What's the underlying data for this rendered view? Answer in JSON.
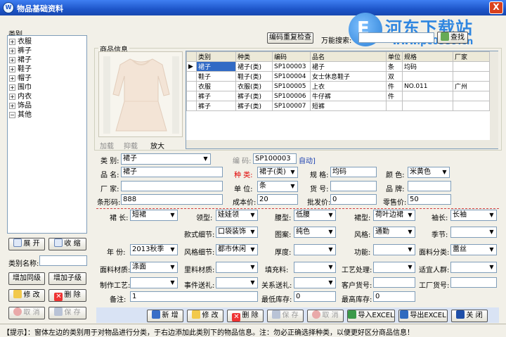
{
  "window": {
    "title": "物品基础资料",
    "icon_label": "W",
    "close_label": "X"
  },
  "watermark": {
    "logo_char": "E",
    "text": "河东下载站",
    "url": "www.pc0359.cn"
  },
  "sidebar": {
    "title": "类别",
    "tree": [
      {
        "sign": "+",
        "label": "衣服"
      },
      {
        "sign": "+",
        "label": "裤子"
      },
      {
        "sign": "+",
        "label": "裙子"
      },
      {
        "sign": "+",
        "label": "鞋子"
      },
      {
        "sign": "+",
        "label": "帽子"
      },
      {
        "sign": "+",
        "label": "围巾"
      },
      {
        "sign": "+",
        "label": "内衣"
      },
      {
        "sign": "+",
        "label": "饰品"
      },
      {
        "sign": "−",
        "label": "其他"
      }
    ],
    "expand_label": "展 开",
    "collapse_label": "收 缩",
    "category_name_label": "类别名称:",
    "category_name_value": "",
    "add_same_level": "增加同级",
    "add_child_level": "增加子级",
    "modify": "修 改",
    "delete": "删 除",
    "cancel": "取 消",
    "save": "保 存"
  },
  "search": {
    "dup_check_label": "编码重复检查",
    "prefix_label": "万能搜索:",
    "query": "",
    "search_label": "查找"
  },
  "goods_info": {
    "section_title": "商品信息",
    "photo_buttons": [
      "加载",
      "抑载",
      "放大"
    ],
    "grid": {
      "columns": [
        "类别",
        "种类",
        "编码",
        "品名",
        "单位",
        "规格",
        "厂家"
      ],
      "rows": [
        {
          "cells": [
            "裙子",
            "裙子(类)",
            "SP100003",
            "裙子",
            "条",
            "均码",
            ""
          ],
          "selected": true
        },
        {
          "cells": [
            "鞋子",
            "鞋子(类)",
            "SP100004",
            "女士休息鞋子",
            "双",
            "",
            ""
          ],
          "selected": false
        },
        {
          "cells": [
            "衣服",
            "衣服(类)",
            "SP100005",
            "上衣",
            "件",
            "NO.011",
            "广州"
          ],
          "selected": false
        },
        {
          "cells": [
            "裤子",
            "裤子(类)",
            "SP100006",
            "牛仔裤",
            "件",
            "",
            ""
          ],
          "selected": false
        },
        {
          "cells": [
            "裤子",
            "裤子(类)",
            "SP100007",
            "短裤",
            "",
            "",
            ""
          ],
          "selected": false
        }
      ]
    }
  },
  "form": {
    "category_label": "类 别:",
    "category_value": "裙子",
    "code_label": "编 码:",
    "code_value": "SP100003",
    "auto_label": "自动]",
    "name_label": "品 名:",
    "name_value": "裙子",
    "kind_label": "种 类:",
    "kind_value": "裙子(类)",
    "spec_label": "规 格:",
    "spec_value": "均码",
    "color_label": "颜 色:",
    "color_value": "米黄色",
    "maker_label": "厂 家:",
    "maker_value": "",
    "unit_label": "单 位:",
    "unit_value": "条",
    "item_no_label": "货 号:",
    "item_no_value": "",
    "brand_label": "品 牌:",
    "brand_value": "",
    "barcode_label": "条形码:",
    "barcode_value": "888",
    "cost_label": "成本价:",
    "cost_value": "20",
    "wholesale_label": "批发价:",
    "wholesale_value": "0",
    "retail_label": "零售价:",
    "retail_value": "50"
  },
  "attributes": {
    "skirt_length_label": "裙 长:",
    "skirt_length_value": "短裙",
    "collar_label": "领型:",
    "collar_value": "娃娃领",
    "waist_label": "腰型:",
    "waist_value": "低腰",
    "skirt_type_label": "裙型:",
    "skirt_type_value": "荷叶边裙",
    "sleeve_label": "袖长:",
    "sleeve_value": "长袖",
    "style_detail_label": "款式细节:",
    "style_detail_value": "口袋装饰",
    "pattern_label": "图案:",
    "pattern_value": "纯色",
    "style_label": "风格:",
    "style_value": "通勤",
    "season_label": "季节:",
    "season_value": "",
    "year_label": "年 份:",
    "year_value": "2013秋季",
    "style_detail2_label": "风格细节:",
    "style_detail2_value": "都市休闲",
    "thickness_label": "厚度:",
    "thickness_value": "",
    "function_label": "功能:",
    "function_value": "",
    "fabric_class_label": "面料分类:",
    "fabric_class_value": "蕾丝",
    "fabric_label": "面料材质:",
    "fabric_value": "涤面",
    "lining_label": "里料材质:",
    "lining_value": "",
    "filling_label": "填充料:",
    "filling_value": "",
    "process_label": "工艺处理:",
    "process_value": "",
    "crowd_label": "适宜人群:",
    "crowd_value": "",
    "make_label": "制作工艺:",
    "make_value": "",
    "event_label": "事件送礼:",
    "event_value": "",
    "gift_label": "关系送礼:",
    "gift_value": "",
    "customer_no_label": "客户货号:",
    "customer_no_value": "",
    "factory_no_label": "工厂货号:",
    "factory_no_value": "",
    "remark_label": "备注:",
    "remark_value": "1",
    "min_stock_label": "最低库存:",
    "min_stock_value": "0",
    "max_stock_label": "最高库存:",
    "max_stock_value": "0"
  },
  "toolbar": {
    "add": "新 增",
    "modify": "修 改",
    "delete": "删 除",
    "save": "保 存",
    "cancel": "取 消",
    "import_excel": "导入EXCEL",
    "export_excel": "导出EXCEL",
    "close": "关 闭"
  },
  "status": {
    "text": "【提示】：窗体左边的类别用于对物品进行分类，于右边添加此类别下的物品信息。注：勿必正确选择种类，以便更好区分商品信息！"
  }
}
